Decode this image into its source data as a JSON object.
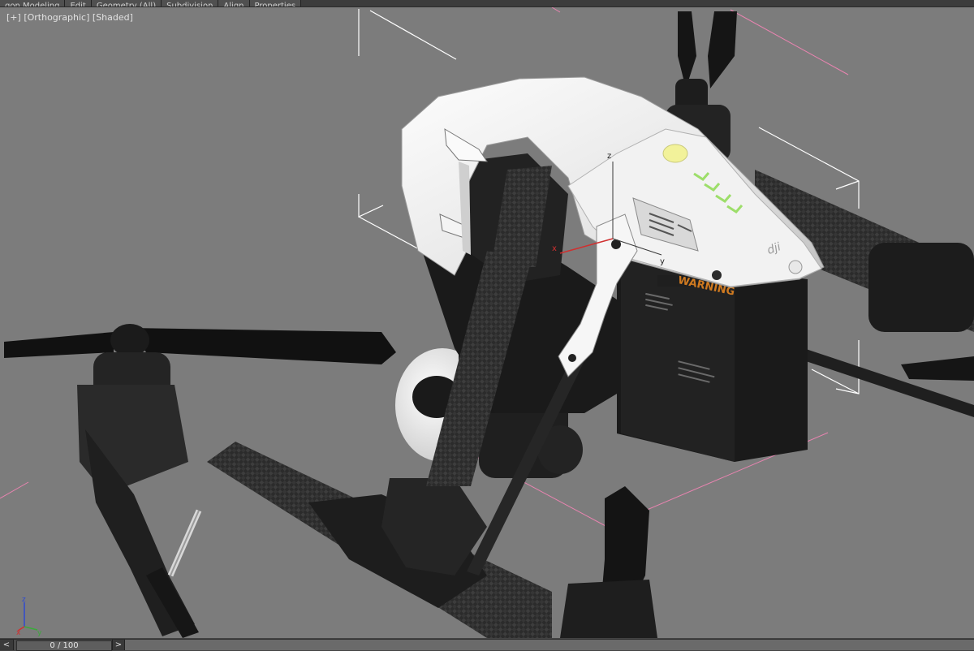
{
  "ribbon": {
    "tabs": [
      "gon Modeling",
      "Edit",
      "Geometry (All)",
      "Subdivision",
      "Align",
      "Properties"
    ]
  },
  "viewport": {
    "label_plus": "[+]",
    "label_view": "[Orthographic]",
    "label_shading": "[Shaded]",
    "background_color": "#7c7c7c"
  },
  "model": {
    "battery_text": "WARNING",
    "logo_text": "dji"
  },
  "gizmo": {
    "x": "x",
    "y": "y",
    "z": "z"
  },
  "tripod": {
    "x": "x",
    "y": "y",
    "z": "z"
  },
  "timeline": {
    "prev": "<",
    "frame": "0 / 100",
    "next": ">"
  },
  "colors": {
    "selection_pink": "#e884b0",
    "bracket_white": "#ffffff",
    "axis_red": "#d03030",
    "led_yellow": "#f2f29a",
    "led_green": "#9dde6a",
    "warning_orange": "#d07a20"
  }
}
